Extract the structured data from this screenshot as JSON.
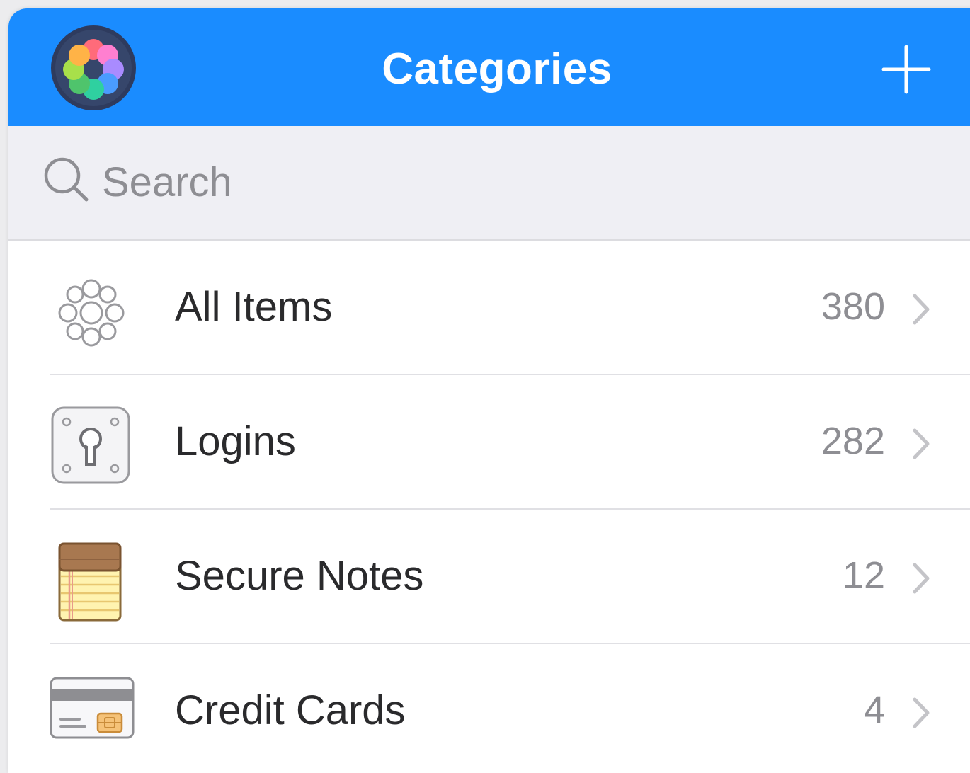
{
  "navbar": {
    "title": "Categories",
    "logo_icon": "rainbow-flower-logo-icon",
    "add_icon": "plus-icon",
    "background": "#1a8cff"
  },
  "search": {
    "placeholder": "Search",
    "value": "",
    "icon": "search-icon"
  },
  "categories": [
    {
      "label": "All Items",
      "count": "380",
      "icon": "all-items-icon"
    },
    {
      "label": "Logins",
      "count": "282",
      "icon": "keyhole-icon"
    },
    {
      "label": "Secure Notes",
      "count": "12",
      "icon": "notepad-icon"
    },
    {
      "label": "Credit Cards",
      "count": "4",
      "icon": "credit-card-icon"
    }
  ]
}
